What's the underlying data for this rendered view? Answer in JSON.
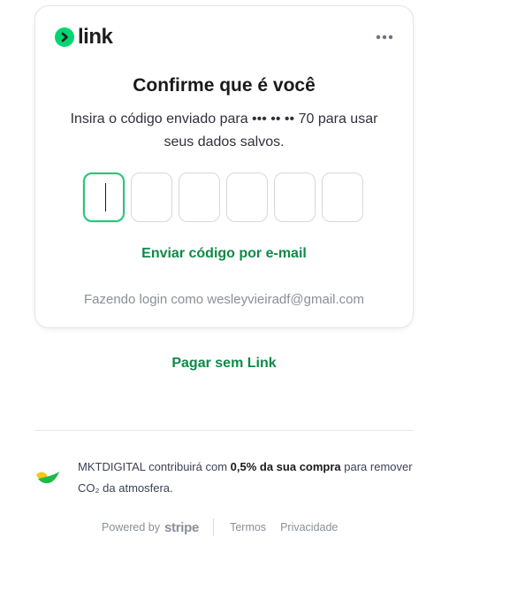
{
  "brand": {
    "name": "link",
    "accent": "#00d66f",
    "icon": "chevron-right-icon"
  },
  "menu": {
    "icon": "more-horizontal-icon"
  },
  "verify": {
    "title": "Confirme que é você",
    "subtitle": "Insira o código enviado para ••• •• •• 70 para usar seus dados salvos.",
    "code_digits": [
      "",
      "",
      "",
      "",
      "",
      ""
    ],
    "active_index": 0,
    "email_link": "Enviar código por e-mail",
    "logged_in_as": "Fazendo login como wesleyvieiradf@gmail.com"
  },
  "pay_without_link": "Pagar sem Link",
  "climate": {
    "icon": "climate-leaf-icon",
    "text_pre": "MKTDIGITAL contribuirá com ",
    "text_bold": "0,5% da sua compra",
    "text_post": " para remover CO₂ da atmosfera."
  },
  "footer": {
    "powered_by": "Powered by",
    "stripe": "stripe",
    "terms": "Termos",
    "privacy": "Privacidade"
  },
  "colors": {
    "link_green": "#0f8a47",
    "focus_green": "#2bc47a",
    "muted": "#8a8f98"
  }
}
